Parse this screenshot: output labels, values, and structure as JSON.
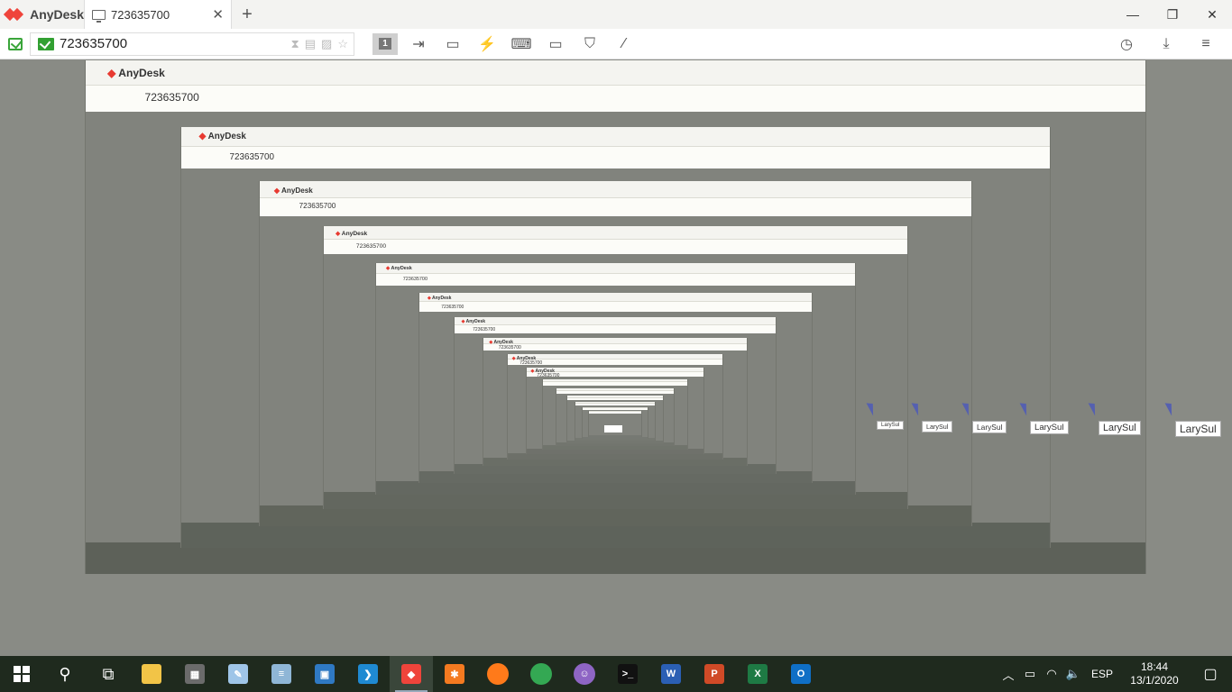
{
  "app": {
    "name": "AnyDesk",
    "logo_color": "#ef443b"
  },
  "tab": {
    "label": "723635700",
    "close_glyph": "✕",
    "add_glyph": "+"
  },
  "window": {
    "minimize_glyph": "—",
    "maximize_glyph": "❐",
    "close_glyph": "✕"
  },
  "address": {
    "value": "723635700"
  },
  "toolbar": {
    "monitor_badge": "1",
    "icons": [
      "switch-sides-icon",
      "chat-icon",
      "actions-icon",
      "keyboard-icon",
      "display-icon",
      "privacy-icon",
      "draw-icon"
    ],
    "right_icons": [
      "history-icon",
      "download-icon",
      "menu-icon"
    ]
  },
  "remote": {
    "cursor_labels": [
      "LarySul",
      "LarySul",
      "LarySul",
      "LarySul",
      "LarySul",
      "LarySul"
    ]
  },
  "taskbar": {
    "apps": [
      {
        "name": "file-explorer",
        "color": "#f2c447",
        "glyph": ""
      },
      {
        "name": "calculator",
        "color": "#6b6b6b",
        "glyph": "▦"
      },
      {
        "name": "paint",
        "color": "#9fc5e8",
        "glyph": "✎"
      },
      {
        "name": "notepad",
        "color": "#8fb6d6",
        "glyph": "≡"
      },
      {
        "name": "remote-desktop",
        "color": "#2f79c3",
        "glyph": "▣"
      },
      {
        "name": "vscode",
        "color": "#1f8ad2",
        "glyph": "❯"
      },
      {
        "name": "anydesk",
        "color": "#ef443b",
        "glyph": "◆"
      },
      {
        "name": "xampp",
        "color": "#f47a20",
        "glyph": "✱"
      },
      {
        "name": "firefox",
        "color": "#ff7a1a",
        "glyph": ""
      },
      {
        "name": "chrome",
        "color": "#34a853",
        "glyph": ""
      },
      {
        "name": "github-desktop",
        "color": "#8e65c4",
        "glyph": "☺"
      },
      {
        "name": "terminal",
        "color": "#111111",
        "glyph": ">_"
      },
      {
        "name": "word",
        "color": "#2b5fb4",
        "glyph": "W"
      },
      {
        "name": "powerpoint",
        "color": "#d04a27",
        "glyph": "P"
      },
      {
        "name": "excel",
        "color": "#1e7a44",
        "glyph": "X"
      },
      {
        "name": "outlook",
        "color": "#0f6fc6",
        "glyph": "O"
      }
    ],
    "language": "ESP",
    "time": "18:44",
    "date": "13/1/2020"
  }
}
